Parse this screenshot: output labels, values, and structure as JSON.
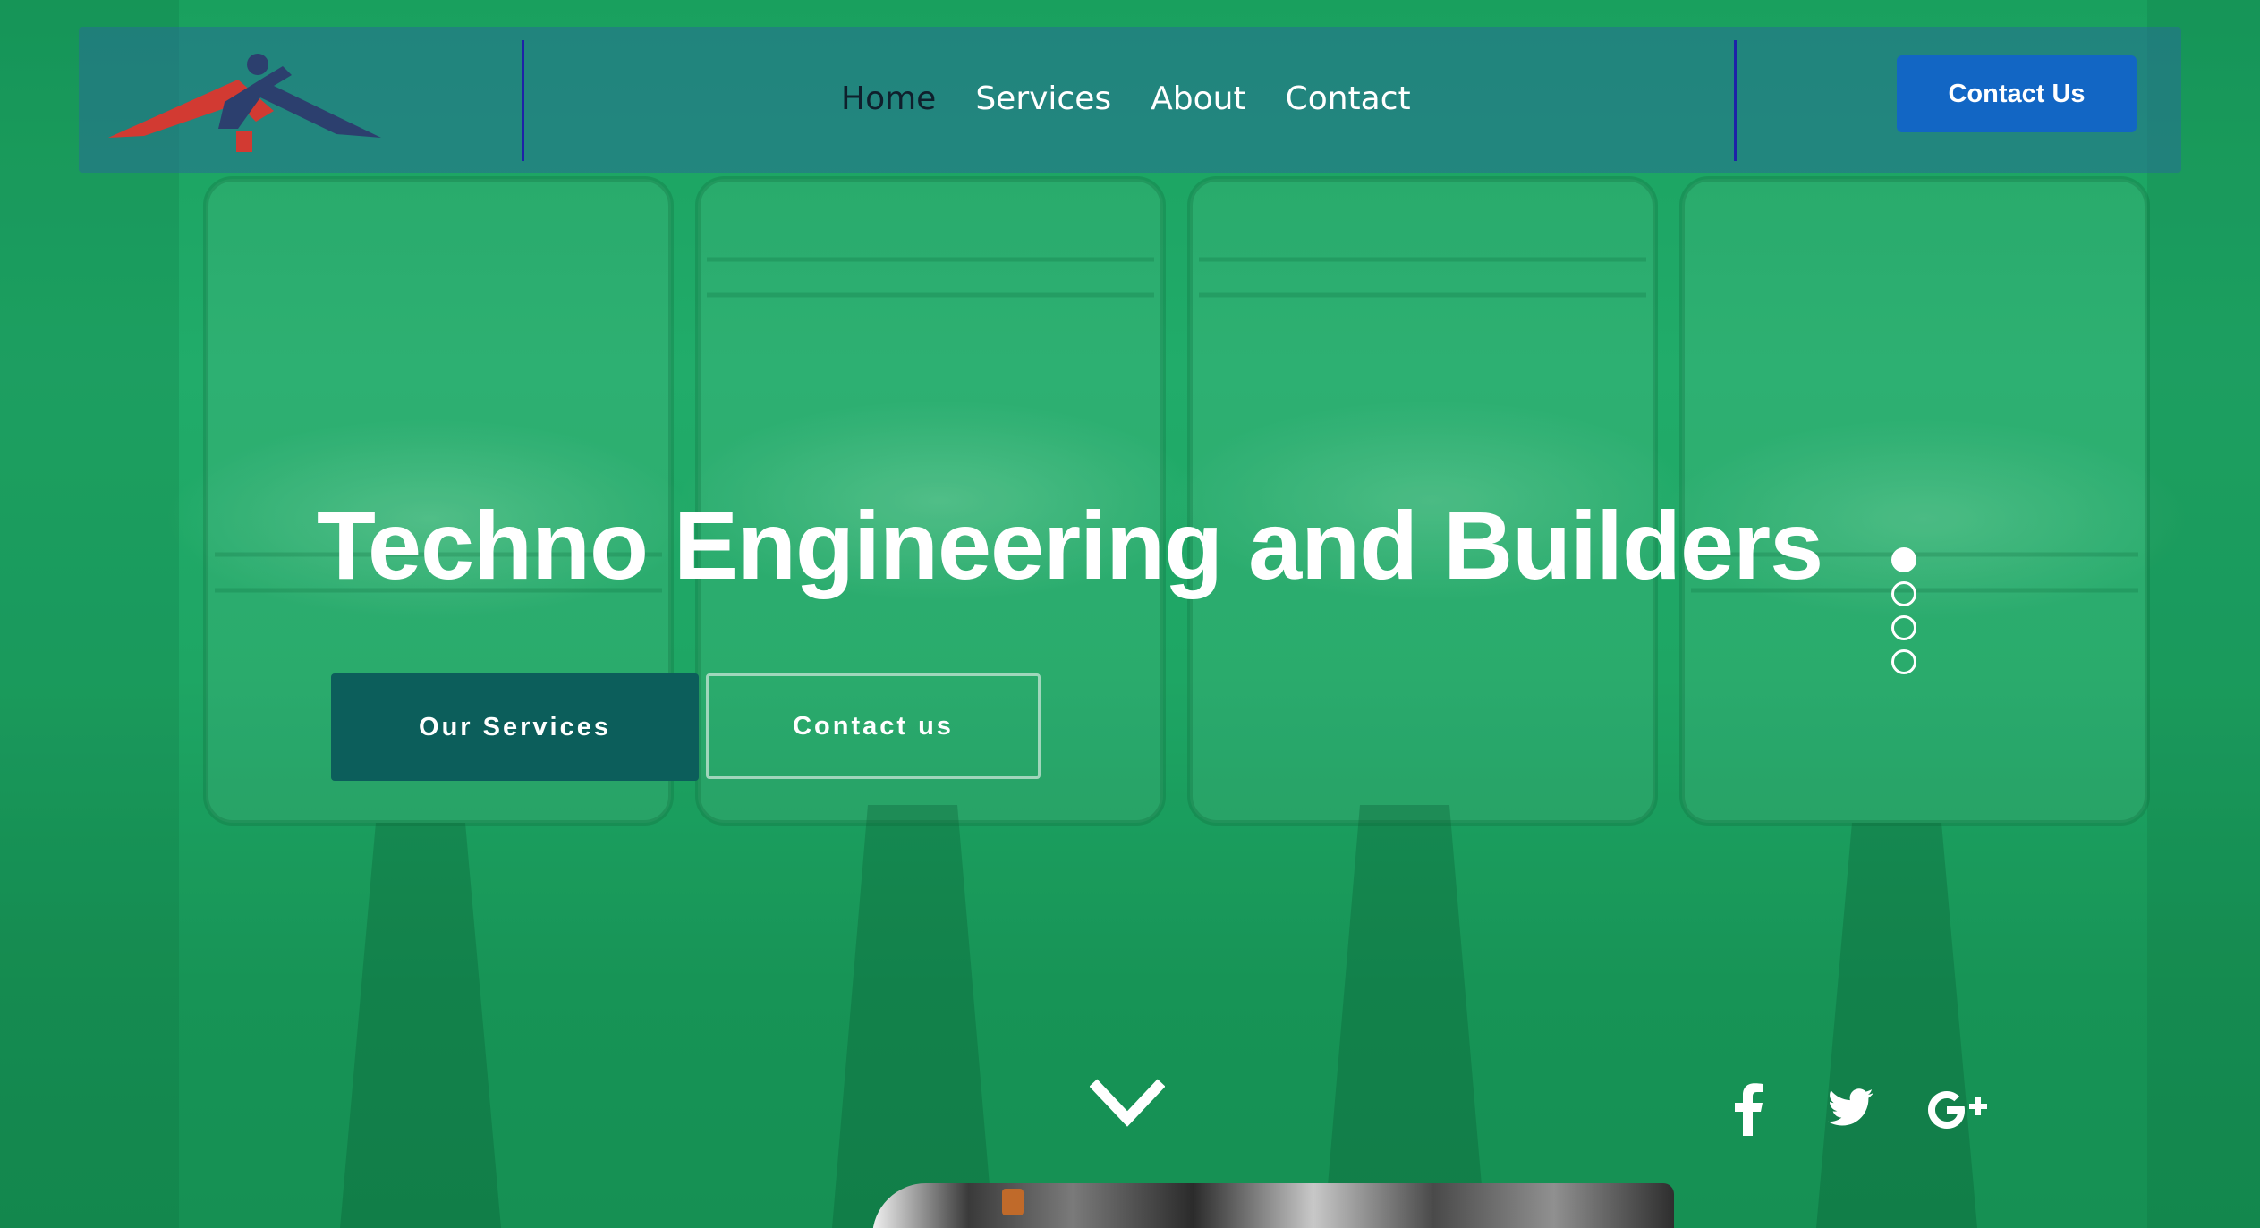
{
  "header": {
    "nav": [
      {
        "label": "Home",
        "active": true
      },
      {
        "label": "Services",
        "active": false
      },
      {
        "label": "About",
        "active": false
      },
      {
        "label": "Contact",
        "active": false
      }
    ],
    "cta_label": "Contact Us"
  },
  "hero": {
    "title": "Techno Engineering and Builders",
    "primary_button": "Our Services",
    "secondary_button": "Contact us",
    "slides": {
      "count": 4,
      "active_index": 0
    }
  },
  "social": [
    {
      "icon": "facebook-icon"
    },
    {
      "icon": "twitter-icon"
    },
    {
      "icon": "google-plus-icon"
    }
  ],
  "colors": {
    "hero_overlay": "#19a464",
    "header_bar": "#2e6e96",
    "header_divider": "#1e22a8",
    "cta_blue": "#1266c4",
    "primary_button": "#0c5e5b",
    "logo_red": "#d23a32",
    "logo_navy": "#2c3f6e"
  }
}
